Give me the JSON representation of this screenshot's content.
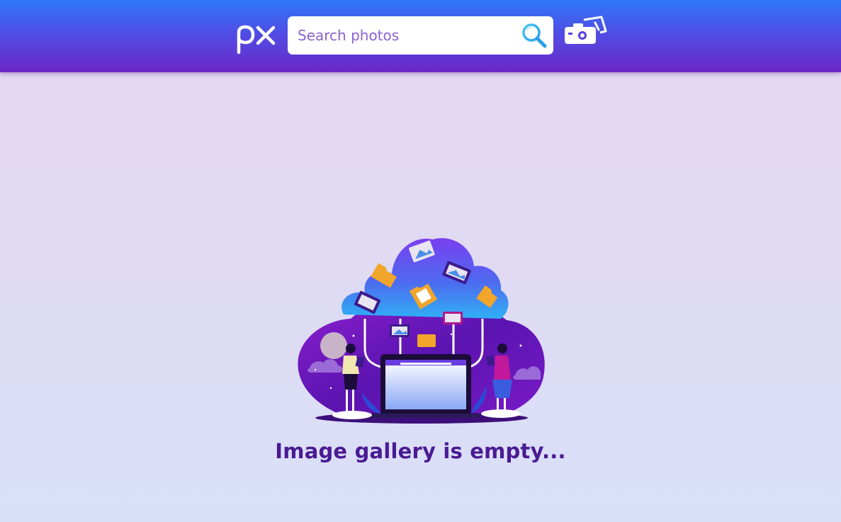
{
  "header": {
    "logo_text": "px",
    "search": {
      "placeholder": "Search photos",
      "value": ""
    },
    "icons": {
      "search": "search-icon",
      "camera": "camera-upload-icon"
    }
  },
  "main": {
    "empty_state": {
      "message": "Image gallery is empty..."
    }
  },
  "colors": {
    "header_top": "#2f78f7",
    "header_bottom": "#6d27c6",
    "message": "#4a1a93",
    "search_icon": "#3fb9f3"
  }
}
